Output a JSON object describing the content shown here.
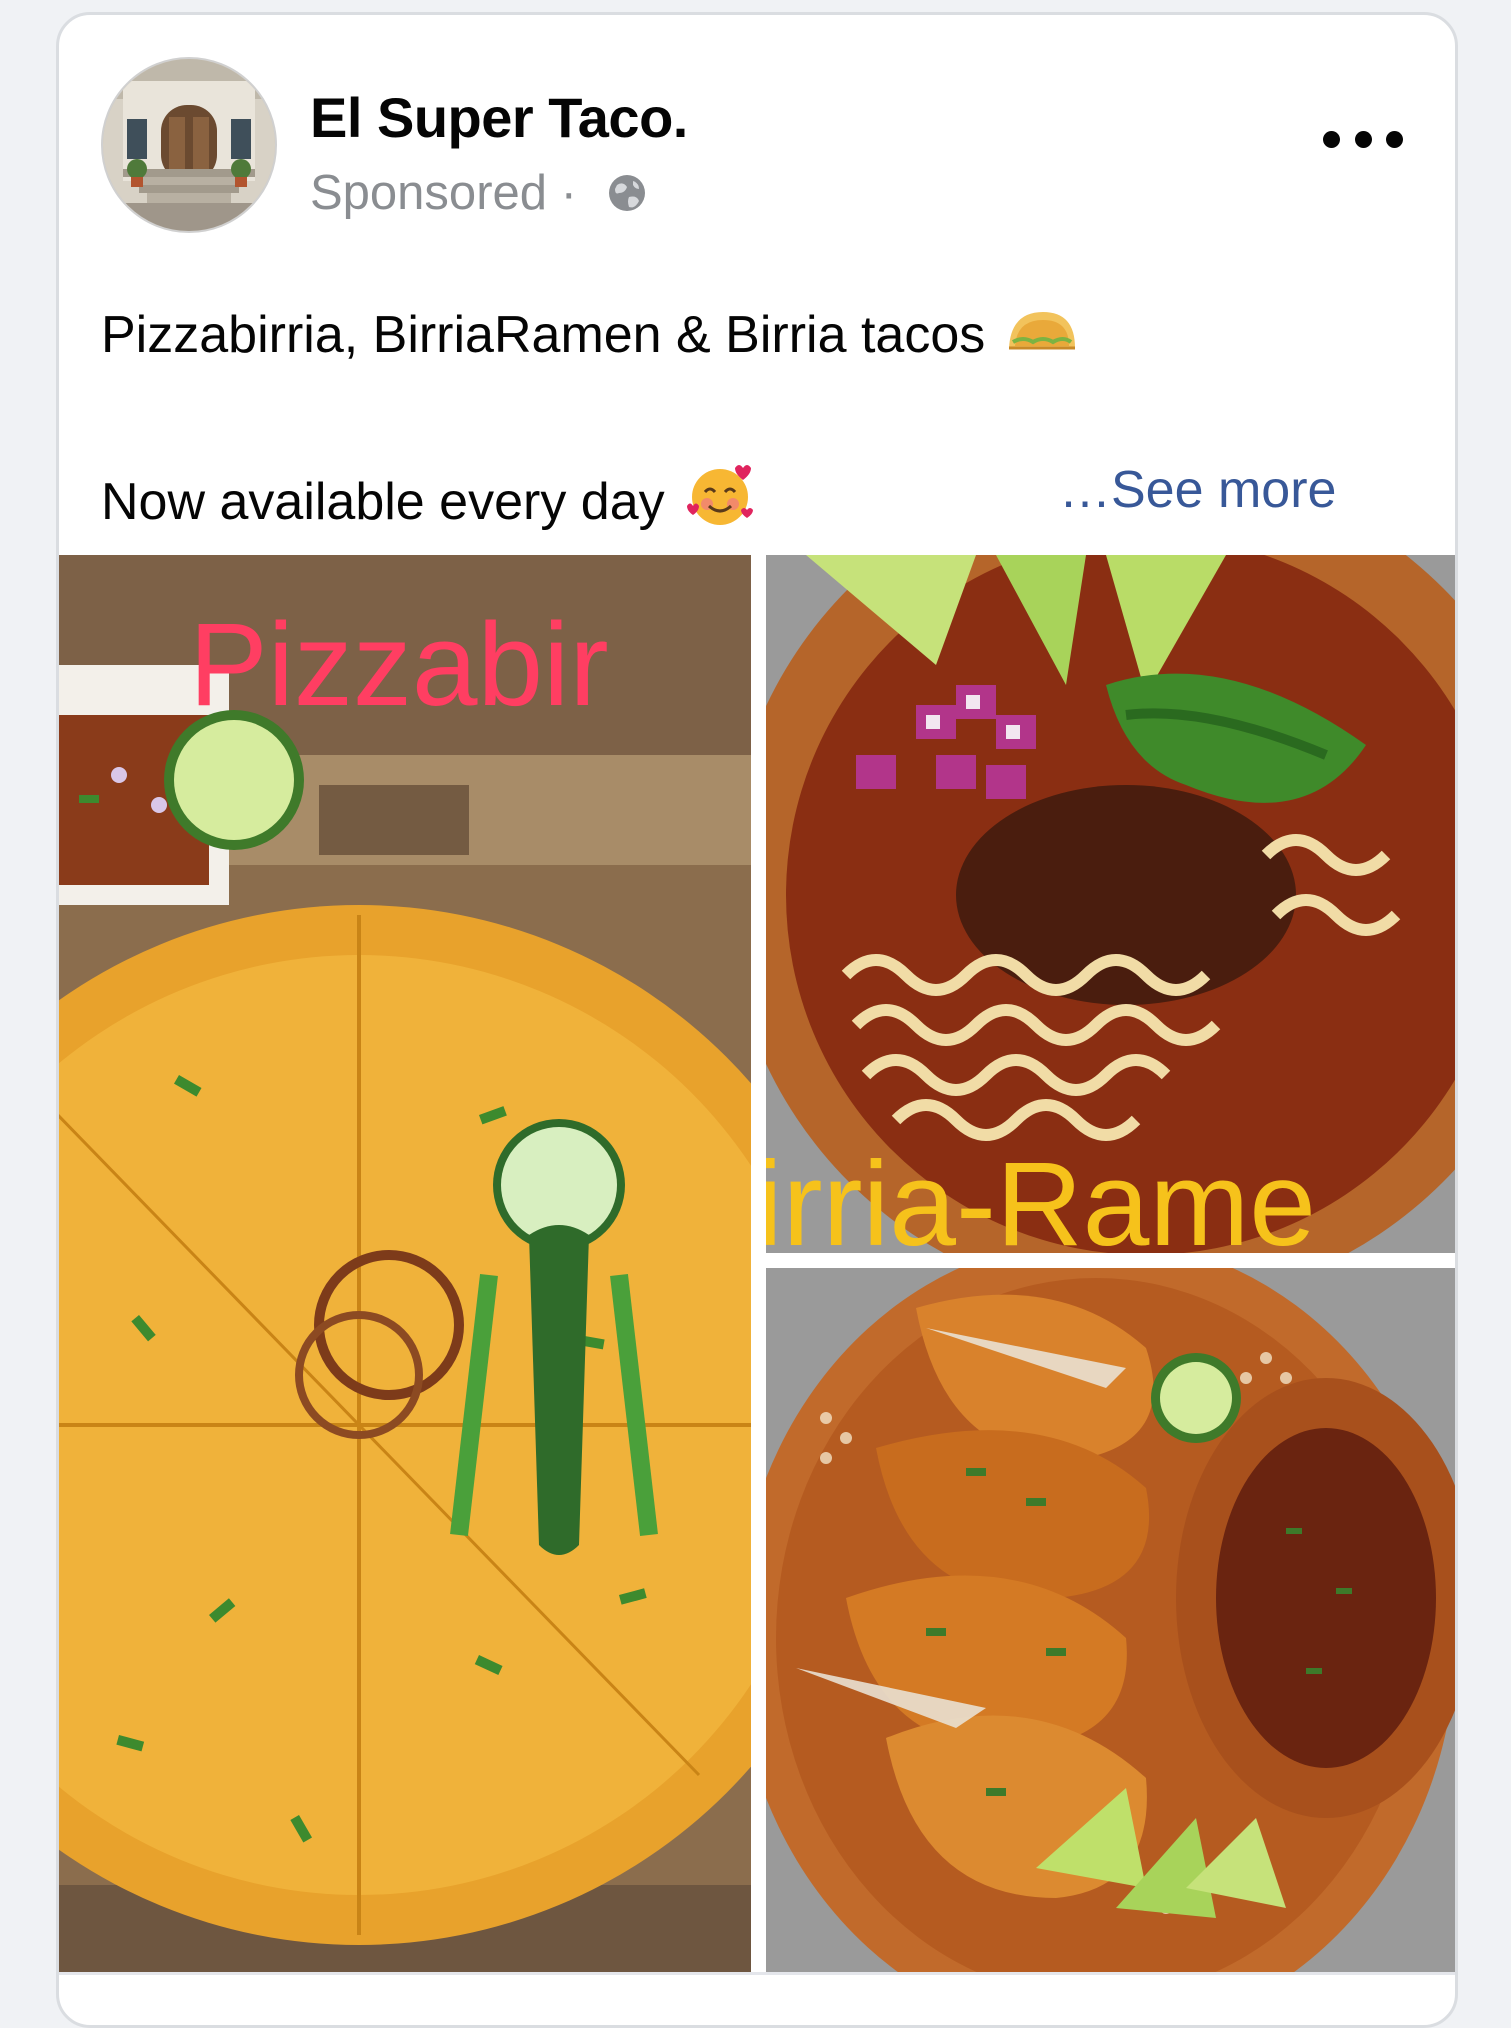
{
  "post": {
    "page_name": "El Super Taco.",
    "sponsored_label": "Sponsored",
    "separator": " · ",
    "text_line1": "Pizzabirria, BirriaRamen & Birria tacos",
    "text_line2": "Now available every day",
    "see_more": "…See more",
    "icons": [
      "globe-icon",
      "more-options-icon",
      "taco-emoji",
      "smiling-face-with-hearts-emoji"
    ]
  },
  "photos": [
    {
      "caption": "Pizzabir"
    },
    {
      "caption": "irria-Rame"
    },
    {
      "caption": ""
    }
  ],
  "colors": {
    "link": "#385898",
    "secondary_text": "#8a8d91",
    "primary_text": "#050505",
    "caption_pink": "#ff3e62",
    "caption_yellow": "#f6c21b"
  }
}
